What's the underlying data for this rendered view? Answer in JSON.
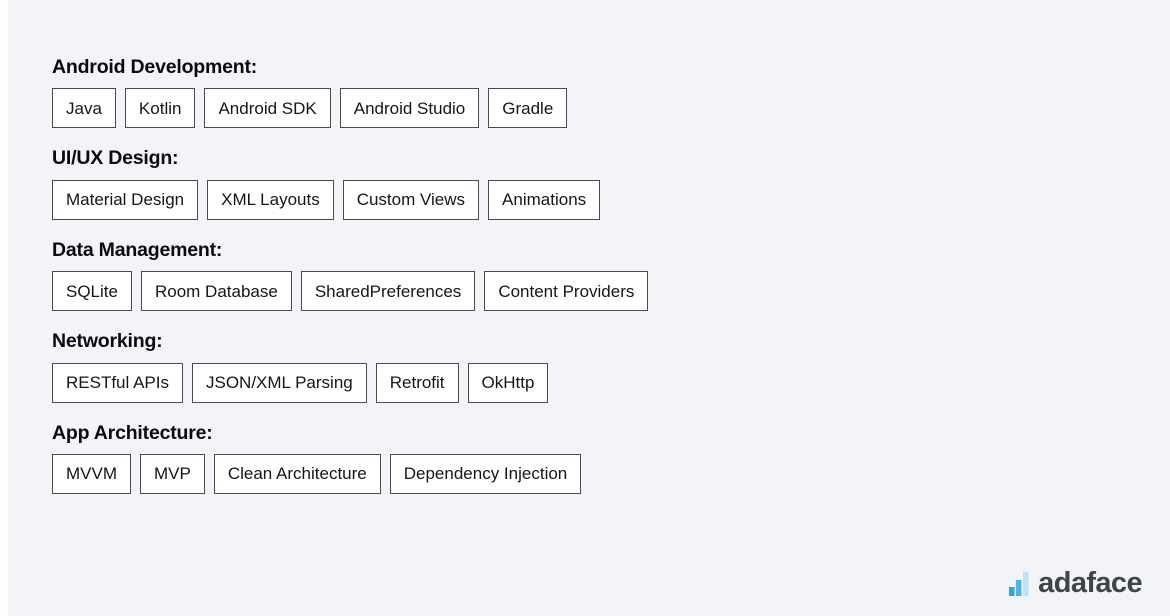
{
  "background_color": "#f2f4f7",
  "skill_groups": [
    {
      "heading": "Android Development:",
      "chips": [
        "Java",
        "Kotlin",
        "Android SDK",
        "Android Studio",
        "Gradle"
      ]
    },
    {
      "heading": "UI/UX Design:",
      "chips": [
        "Material Design",
        "XML Layouts",
        "Custom Views",
        "Animations"
      ]
    },
    {
      "heading": "Data Management:",
      "chips": [
        "SQLite",
        "Room Database",
        "SharedPreferences",
        "Content Providers"
      ]
    },
    {
      "heading": "Networking:",
      "chips": [
        "RESTful APIs",
        "JSON/XML Parsing",
        "Retrofit",
        "OkHttp"
      ]
    },
    {
      "heading": "App Architecture:",
      "chips": [
        "MVVM",
        "MVP",
        "Clean Architecture",
        "Dependency Injection"
      ]
    }
  ],
  "brand": {
    "name": "adaface",
    "icon": "bar-chart-logo-icon",
    "wordmark_color": "#3f4448",
    "bar_colors": [
      "#3aa0ee",
      "#4ab4f0",
      "#bfe0f5"
    ]
  }
}
